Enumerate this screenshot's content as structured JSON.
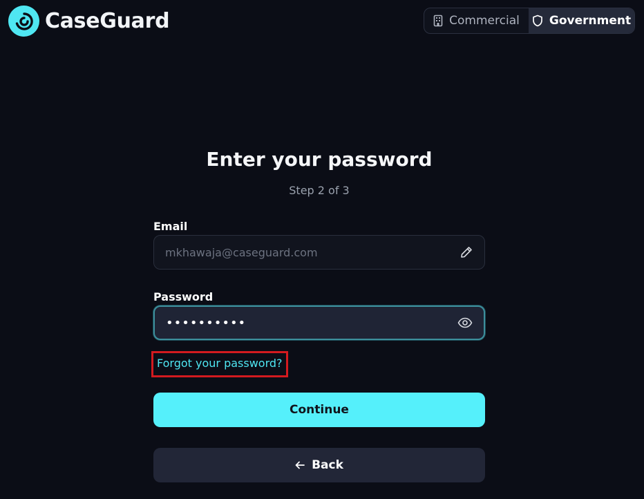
{
  "brand": {
    "name": "CaseGuard",
    "logo_icon": "swirl-logo-icon",
    "accent_color": "#4fe6f2"
  },
  "header": {
    "toggle": {
      "commercial_label": "Commercial",
      "commercial_icon": "building-icon",
      "government_label": "Government",
      "government_icon": "shield-icon",
      "selected": "Government"
    }
  },
  "form": {
    "title": "Enter your password",
    "step": "Step 2 of 3",
    "email": {
      "label": "Email",
      "value": "mkhawaja@caseguard.com",
      "icon": "pencil-icon"
    },
    "password": {
      "label": "Password",
      "value": "••••••••••",
      "icon": "eye-icon"
    },
    "forgot_label": "Forgot your password?",
    "continue_label": "Continue",
    "back_label": "Back",
    "back_icon": "arrow-left-icon"
  }
}
